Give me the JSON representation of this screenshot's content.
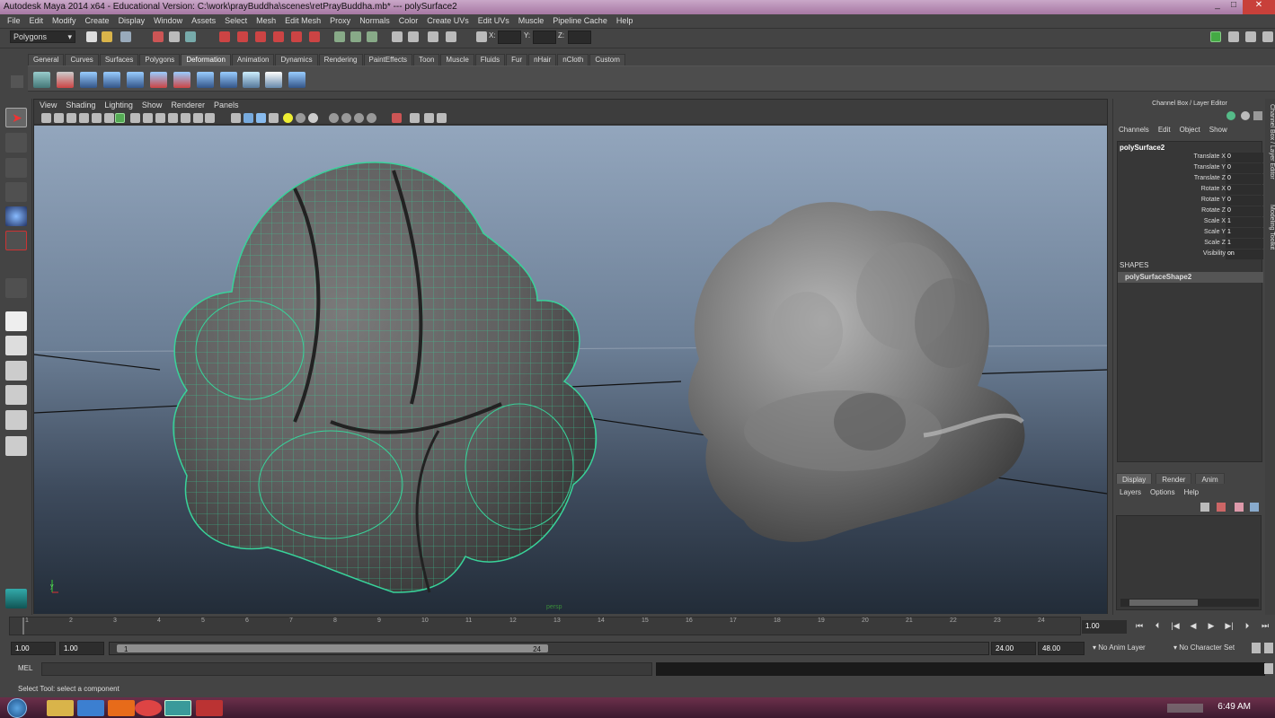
{
  "window": {
    "title": "Autodesk Maya 2014 x64 - Educational Version: C:\\work\\prayBuddha\\scenes\\retPrayBuddha.mb*  ---  polySurface2"
  },
  "menubar": [
    "File",
    "Edit",
    "Modify",
    "Create",
    "Display",
    "Window",
    "Assets",
    "Select",
    "Mesh",
    "Edit Mesh",
    "Proxy",
    "Normals",
    "Color",
    "Create UVs",
    "Edit UVs",
    "Muscle",
    "Pipeline Cache",
    "Help"
  ],
  "status_line": {
    "mode": "Polygons",
    "x_label": "X:",
    "y_label": "Y:",
    "z_label": "Z:"
  },
  "shelf_tabs": [
    "General",
    "Curves",
    "Surfaces",
    "Polygons",
    "Deformation",
    "Animation",
    "Dynamics",
    "Rendering",
    "PaintEffects",
    "Toon",
    "Muscle",
    "Fluids",
    "Fur",
    "nHair",
    "nCloth",
    "Custom"
  ],
  "active_shelf": "Deformation",
  "viewport": {
    "menu": [
      "View",
      "Shading",
      "Lighting",
      "Show",
      "Renderer",
      "Panels"
    ],
    "camera_label": "persp"
  },
  "channel_box": {
    "title": "Channel Box / Layer Editor",
    "menu": [
      "Channels",
      "Edit",
      "Object",
      "Show"
    ],
    "object": "polySurface2",
    "attributes": [
      {
        "label": "Translate X",
        "value": "0"
      },
      {
        "label": "Translate Y",
        "value": "0"
      },
      {
        "label": "Translate Z",
        "value": "0"
      },
      {
        "label": "Rotate X",
        "value": "0"
      },
      {
        "label": "Rotate Y",
        "value": "0"
      },
      {
        "label": "Rotate Z",
        "value": "0"
      },
      {
        "label": "Scale X",
        "value": "1"
      },
      {
        "label": "Scale Y",
        "value": "1"
      },
      {
        "label": "Scale Z",
        "value": "1"
      },
      {
        "label": "Visibility",
        "value": "on"
      }
    ],
    "shapes_header": "SHAPES",
    "shape": "polySurfaceShape2"
  },
  "layer_editor": {
    "tabs": [
      "Display",
      "Render",
      "Anim"
    ],
    "active_tab": "Display",
    "menu": [
      "Layers",
      "Options",
      "Help"
    ]
  },
  "side_tabs": [
    "Channel Box / Layer Editor",
    "Modeling Toolkit"
  ],
  "time_slider": {
    "ticks": [
      "1",
      "2",
      "3",
      "4",
      "5",
      "6",
      "7",
      "8",
      "9",
      "10",
      "11",
      "12",
      "13",
      "14",
      "15",
      "16",
      "17",
      "18",
      "19",
      "20",
      "21",
      "22",
      "23",
      "24"
    ],
    "current_frame": "1.00"
  },
  "range_slider": {
    "start_time": "1.00",
    "playback_start": "1.00",
    "range_start": "1",
    "range_end": "24",
    "playback_end": "24.00",
    "end_time": "48.00",
    "anim_layer": "No Anim Layer",
    "character_set": "No Character Set"
  },
  "command_line": {
    "label": "MEL"
  },
  "help_line": "Select Tool: select a component",
  "taskbar": {
    "time": "6:49 AM"
  }
}
